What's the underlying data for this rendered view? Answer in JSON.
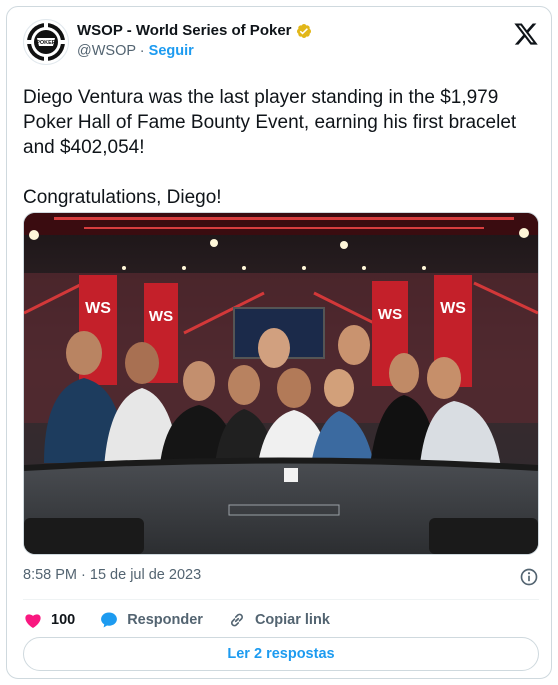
{
  "account": {
    "display_name": "WSOP - World Series of Poker",
    "handle": "@WSOP",
    "separator": " · ",
    "follow_label": "Seguir",
    "logo_text": "POKER",
    "verified": true
  },
  "tweet": {
    "text": "Diego Ventura was the last player standing in the $1,979 Poker Hall of Fame Bounty Event, earning his first bracelet and $402,054!\n\nCongratulations, Diego!",
    "timestamp": "8:58 PM · 15 de jul de 2023"
  },
  "photo": {
    "banner_letters": "WS",
    "alt": ""
  },
  "actions": {
    "likes": "100",
    "reply_label": "Responder",
    "copy_label": "Copiar link",
    "read_replies_label": "Ler 2 respostas"
  },
  "colors": {
    "accent": "#1d9bf0",
    "like": "#f91880",
    "muted": "#536471",
    "verified_badge": "#e2b719"
  }
}
